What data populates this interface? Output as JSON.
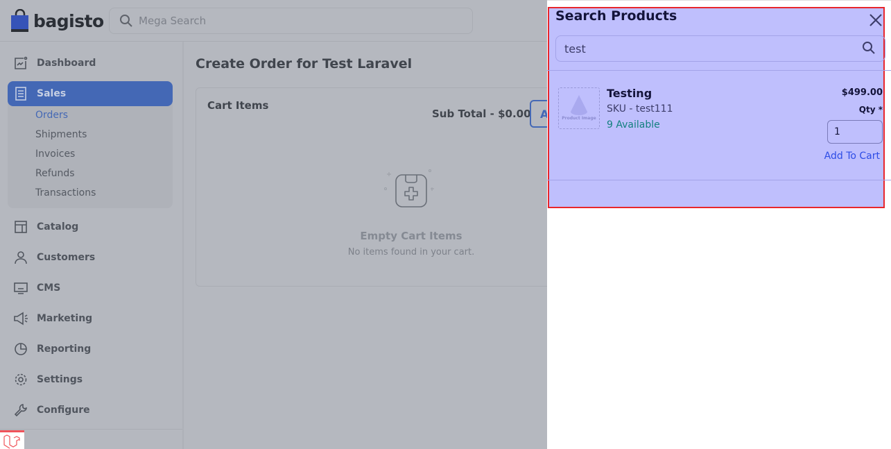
{
  "header": {
    "logo": "bagisto",
    "search_placeholder": "Mega Search"
  },
  "sidebar": {
    "items": [
      {
        "label": "Dashboard",
        "icon": "dashboard-icon"
      },
      {
        "label": "Sales",
        "icon": "sales-icon",
        "active": true
      },
      {
        "label": "Catalog",
        "icon": "catalog-icon"
      },
      {
        "label": "Customers",
        "icon": "customers-icon"
      },
      {
        "label": "CMS",
        "icon": "cms-icon"
      },
      {
        "label": "Marketing",
        "icon": "marketing-icon"
      },
      {
        "label": "Reporting",
        "icon": "reporting-icon"
      },
      {
        "label": "Settings",
        "icon": "settings-icon"
      },
      {
        "label": "Configure",
        "icon": "configure-icon"
      }
    ],
    "sales_sub": [
      "Orders",
      "Shipments",
      "Invoices",
      "Refunds",
      "Transactions"
    ],
    "active_sub": "Orders"
  },
  "main": {
    "title": "Create Order for Test Laravel",
    "cart": {
      "title": "Cart Items",
      "subtotal": "Sub Total - $0.00",
      "button_partial": "A",
      "empty_title": "Empty Cart Items",
      "empty_text": "No items found in your cart."
    }
  },
  "drawer": {
    "title": "Search Products",
    "search_value": "test",
    "product": {
      "name": "Testing",
      "sku": "SKU - test111",
      "available": "9 Available",
      "price": "$499.00",
      "qty_label": "Qty *",
      "qty_value": "1",
      "add_label": "Add To Cart",
      "image_label": "Product Image"
    }
  },
  "colors": {
    "accent": "#4468b5",
    "highlight": "#bfbffd",
    "highlight_border": "#e8262b",
    "available": "#13807f",
    "link": "#2d4ce6"
  }
}
